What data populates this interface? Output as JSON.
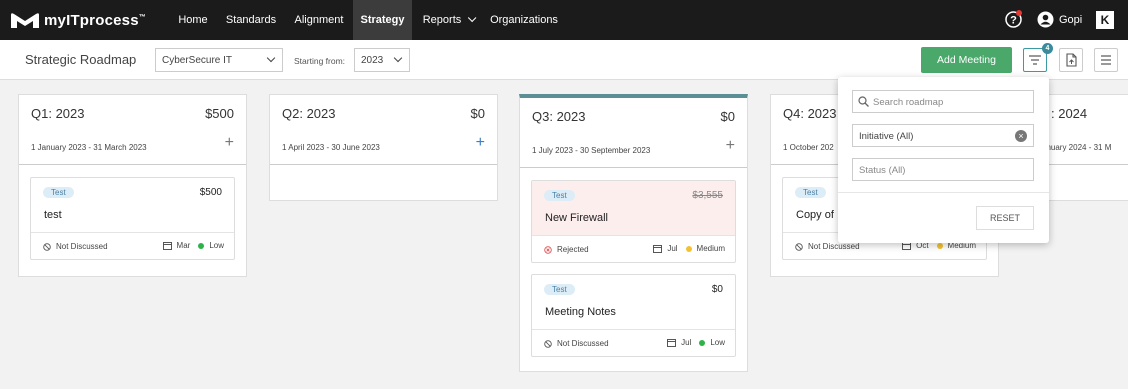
{
  "app": {
    "logo_text": "myITprocess",
    "logo_tm": "™"
  },
  "nav": {
    "items": [
      {
        "label": "Home"
      },
      {
        "label": "Standards"
      },
      {
        "label": "Alignment"
      },
      {
        "label": "Strategy",
        "active": true
      },
      {
        "label": "Reports"
      },
      {
        "label": "Organizations"
      }
    ],
    "user": "Gopi",
    "brand_k": "K"
  },
  "toolbar": {
    "title": "Strategic Roadmap",
    "client": "CyberSecure IT",
    "starting_from_label": "Starting from:",
    "year": "2023",
    "add_meeting": "Add Meeting",
    "filter_count": "4"
  },
  "columns": [
    {
      "title": "Q1: 2023",
      "total": "$500",
      "dates": "1 January 2023 - 31 March 2023",
      "cards": [
        {
          "tag": "Test",
          "amount": "$500",
          "title": "test",
          "status": "Not Discussed",
          "month": "Mar",
          "priority": "Low"
        }
      ]
    },
    {
      "title": "Q2: 2023",
      "total": "$0",
      "dates": "1 April 2023 - 30 June 2023",
      "cards": []
    },
    {
      "title": "Q3: 2023",
      "total": "$0",
      "dates": "1 July 2023 - 30 September 2023",
      "cards": [
        {
          "tag": "Test",
          "amount": "$3,555",
          "title": "New Firewall",
          "status": "Rejected",
          "month": "Jul",
          "priority": "Medium"
        },
        {
          "tag": "Test",
          "amount": "$0",
          "title": "Meeting Notes",
          "status": "Not Discussed",
          "month": "Jul",
          "priority": "Low"
        }
      ]
    },
    {
      "title": "Q4: 2023",
      "dates": "1 October 202",
      "cards": [
        {
          "tag": "Test",
          "title": "Copy of",
          "status": "Not Discussed",
          "month": "Oct",
          "priority": "Medium"
        }
      ]
    },
    {
      "title": ": 2024",
      "dates": "anuary 2024 - 31 M",
      "cards": []
    }
  ],
  "filter_panel": {
    "search_placeholder": "Search roadmap",
    "initiative": "Initiative (All)",
    "status_placeholder": "Status (All)",
    "reset": "RESET"
  },
  "colors": {
    "accent_green": "#4aa86b",
    "teal": "#5c8f95",
    "low": "#2db34a",
    "medium": "#f2c232",
    "rejected": "#e05353"
  }
}
